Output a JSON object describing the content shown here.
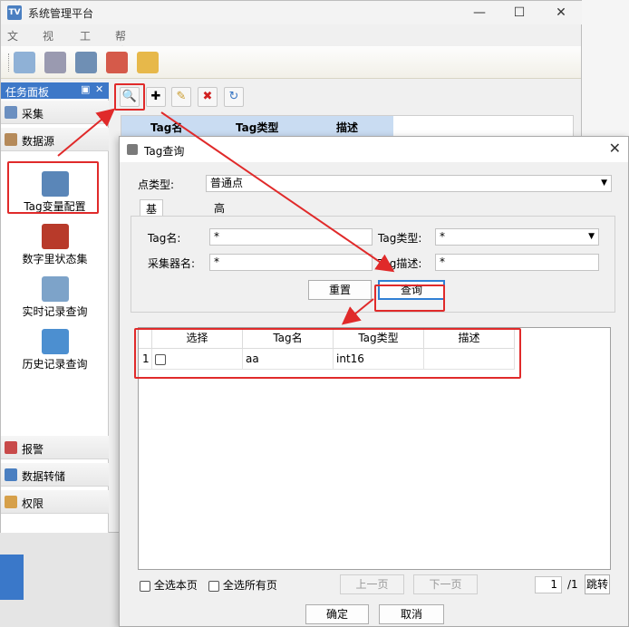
{
  "window": {
    "title": "系统管理平台",
    "icon_text": "TV"
  },
  "menu": [
    "文件",
    "视图",
    "工具",
    "帮助"
  ],
  "toolbar_icons": [
    "import-icon",
    "tools-icon",
    "settings-icon",
    "network-icon",
    "alarm-icon"
  ],
  "task_panel": {
    "title": "任务面板",
    "groups_top": [
      {
        "label": "采集",
        "icon": "collect-icon",
        "color": "#6b8fc0"
      },
      {
        "label": "数据源",
        "icon": "datasource-icon",
        "color": "#b58a5a"
      }
    ],
    "tools": [
      {
        "label": "Tag变量配置",
        "icon": "database-gear-icon",
        "color": "#5a86b8"
      },
      {
        "label": "数字里状态集",
        "icon": "digital-state-icon",
        "color": "#b83a2a"
      },
      {
        "label": "实时记录查询",
        "icon": "realtime-record-icon",
        "color": "#7da3c9"
      },
      {
        "label": "历史记录查询",
        "icon": "history-record-icon",
        "color": "#4c8fd0"
      }
    ],
    "groups_bottom": [
      {
        "label": "报警",
        "icon": "alarm-group-icon",
        "color": "#c84a4a"
      },
      {
        "label": "数据转储",
        "icon": "transfer-icon",
        "color": "#4a7fc1"
      },
      {
        "label": "权限",
        "icon": "permission-icon",
        "color": "#d6a04a"
      }
    ]
  },
  "grid_header": [
    "Tag名",
    "Tag类型",
    "描述"
  ],
  "dialog": {
    "title": "Tag查询",
    "point_type_label": "点类型:",
    "point_type_value": "普通点",
    "tabs": [
      "基本查询",
      "高级查询"
    ],
    "tag_name_label": "Tag名:",
    "tag_name_value": "*",
    "tag_type_label": "Tag类型:",
    "tag_type_value": "*",
    "collector_label": "采集器名:",
    "collector_value": "*",
    "tag_desc_label": "Tag描述:",
    "tag_desc_value": "*",
    "reset_label": "重置",
    "query_label": "查询",
    "result_columns": [
      "选择",
      "Tag名",
      "Tag类型",
      "描述"
    ],
    "result_rows": [
      {
        "index": "1",
        "tag_name": "aa",
        "tag_type": "int16",
        "desc": ""
      }
    ],
    "select_page_label": "全选本页",
    "select_all_label": "全选所有页",
    "prev_page_label": "上一页",
    "next_page_label": "下一页",
    "page_value": "1",
    "page_total": "/1",
    "jump_label": "跳转",
    "ok_label": "确定",
    "cancel_label": "取消"
  }
}
